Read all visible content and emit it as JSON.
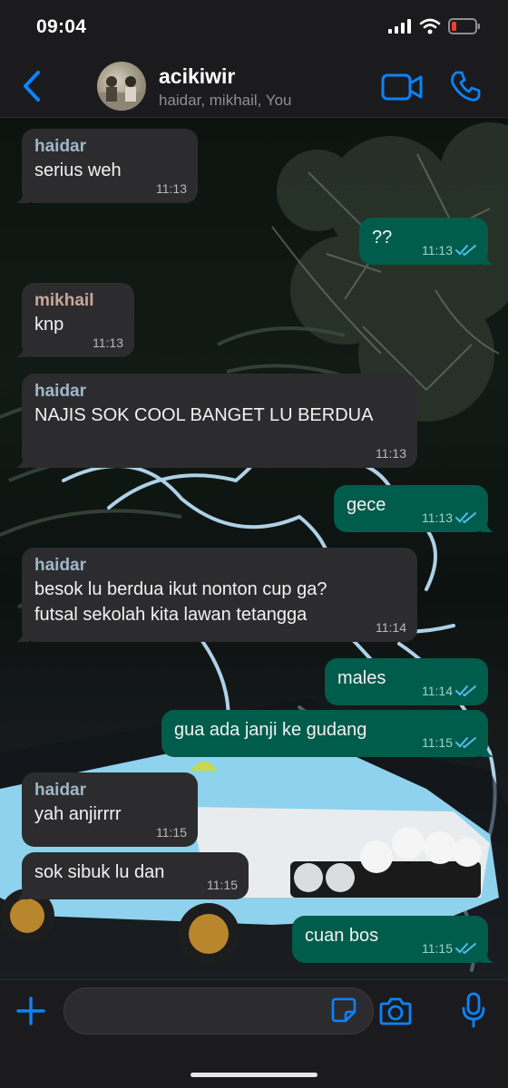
{
  "status_bar": {
    "time": "09:04"
  },
  "header": {
    "title": "acikiwir",
    "subtitle": "haidar, mikhail, You"
  },
  "colors": {
    "accent": "#0a84ff",
    "outgoing_bubble": "#005c4b",
    "incoming_bubble": "#2c2c2e",
    "sender_haidar": "#9fb7c9",
    "sender_mikhail": "#c9a89a",
    "read_ticks": "#53bdeb"
  },
  "messages": [
    {
      "direction": "in",
      "sender": "haidar",
      "text": "serius weh",
      "time": "11:13"
    },
    {
      "direction": "out",
      "text": "??",
      "time": "11:13"
    },
    {
      "direction": "in",
      "sender": "mikhail",
      "text": "knp",
      "time": "11:13"
    },
    {
      "direction": "in",
      "sender": "haidar",
      "text": "NAJIS SOK COOL BANGET LU BERDUA",
      "time": "11:13"
    },
    {
      "direction": "out",
      "text": "gece",
      "time": "11:13"
    },
    {
      "direction": "in",
      "sender": "haidar",
      "text": "besok lu berdua ikut nonton cup ga?\nfutsal sekolah kita lawan tetangga",
      "time": "11:14"
    },
    {
      "direction": "out",
      "text": "males",
      "time": "11:14"
    },
    {
      "direction": "out",
      "text": "gua ada janji ke gudang",
      "time": "11:15"
    },
    {
      "direction": "in",
      "sender": "haidar",
      "text": "yah anjirrrr",
      "time": "11:15"
    },
    {
      "direction": "in",
      "text": "sok sibuk lu dan",
      "time": "11:15"
    },
    {
      "direction": "out",
      "text": "cuan bos",
      "time": "11:15"
    }
  ],
  "input": {
    "placeholder": ""
  },
  "icons": {
    "back": "chevron-left-icon",
    "video": "video-camera-icon",
    "call": "phone-icon",
    "plus": "plus-icon",
    "sticker": "sticker-icon",
    "camera": "camera-icon",
    "mic": "microphone-icon"
  }
}
